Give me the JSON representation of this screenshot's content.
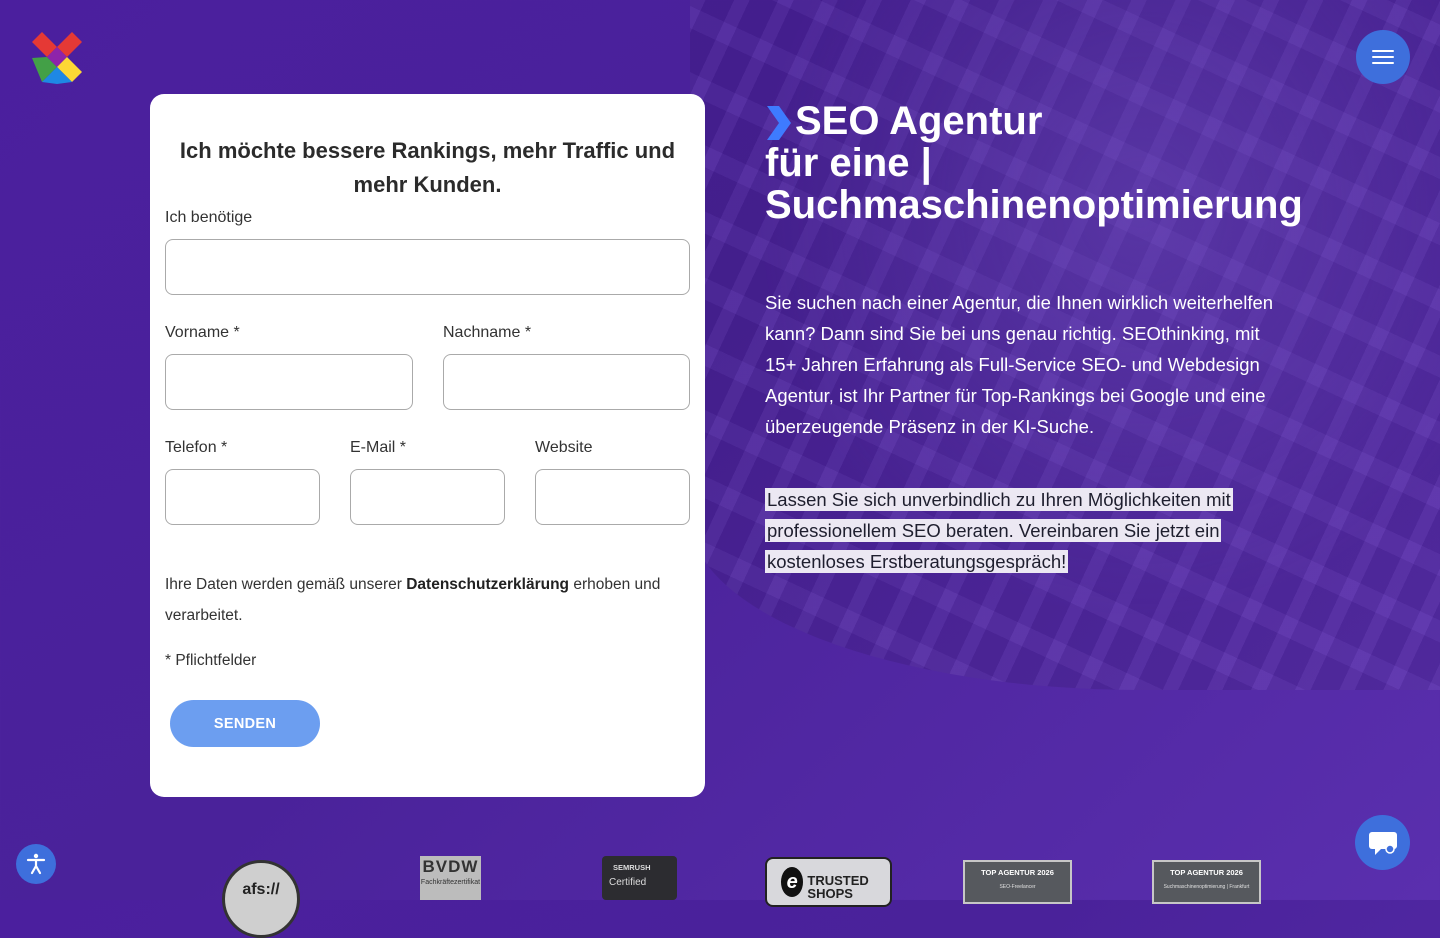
{
  "header": {
    "logo_name": "colorful-x-logo",
    "menu_icon": "hamburger-icon"
  },
  "form": {
    "heading": "Ich möchte bessere Rankings, mehr Traffic und mehr Kunden.",
    "need_label": "Ich benötige",
    "firstname_label": "Vorname *",
    "lastname_label": "Nachname *",
    "phone_label": "Telefon *",
    "email_label": "E-Mail *",
    "website_label": "Website",
    "privacy_prefix": "Ihre Daten werden gemäß unserer ",
    "privacy_link": "Datenschutzerklärung",
    "privacy_suffix": " erhoben und verarbeitet.",
    "required_note": "* Pflichtfelder",
    "submit_label": "SENDEN"
  },
  "hero": {
    "title_line1": "SEO Agentur",
    "title_line2": "für eine |",
    "title_line3": "Suchmaschinenoptimierung",
    "paragraph": "Sie suchen nach einer Agentur, die Ihnen wirklich weiterhelfen kann? Dann sind Sie bei uns genau richtig. SEOthinking, mit 15+ Jahren Erfahrung als Full-Service SEO- und Webdesign Agentur, ist Ihr Partner für Top-Rankings bei Google und eine überzeugende Präsenz in der KI-Suche.",
    "highlight": "Lassen Sie sich unverbindlich zu Ihren Möglichkeiten mit professionellem SEO beraten. Vereinbaren Sie jetzt ein kostenloses Erstberatungsgespräch!"
  },
  "badges": {
    "afs": "afs://",
    "bvdw_title": "BVDW",
    "bvdw_sub": "Fachkräftezertifikat",
    "semrush_title": "SEMRUSH",
    "semrush_sub": "Certified",
    "trusted": "TRUSTED SHOPS",
    "top1_title": "TOP AGENTUR 2026",
    "top1_sub": "SEO-Freelancer",
    "top2_title": "TOP AGENTUR 2026",
    "top2_sub": "Suchmaschinenoptimierung | Frankfurt"
  },
  "colors": {
    "background": "#4b1f9e",
    "accent": "#3e6fdc",
    "button": "#6c9ef0",
    "chevron": "#3e7bff"
  }
}
